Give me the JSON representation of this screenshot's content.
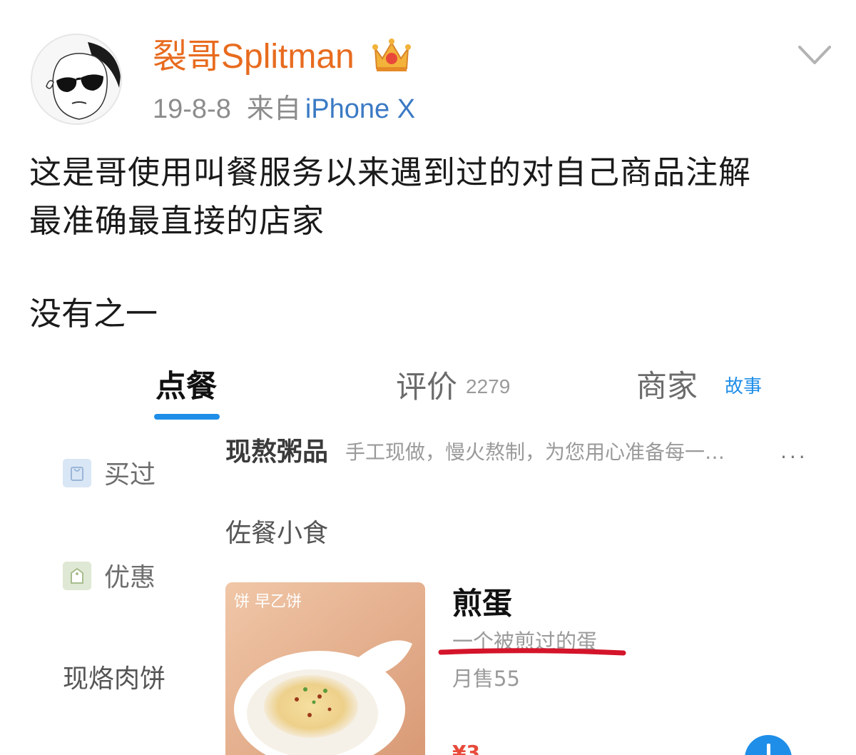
{
  "post": {
    "username": "裂哥Splitman",
    "date": "19-8-8",
    "from_label": "来自",
    "device": "iPhone X",
    "text_line1": "这是哥使用叫餐服务以来遇到过的对自己商品注解",
    "text_line2": "最准确最直接的店家",
    "text_line3": "没有之一"
  },
  "screenshot": {
    "tabs": {
      "order": "点餐",
      "reviews": "评价",
      "reviews_count": "2279",
      "merchant": "商家",
      "merchant_story": "故事"
    },
    "sidebar": {
      "bought": "买过",
      "discount": "优惠",
      "patty": "现烙肉饼"
    },
    "category1": {
      "title": "现熬粥品",
      "desc": "手工现做，慢火熬制，为您用心准备每一…"
    },
    "more": "···",
    "category2": {
      "title": "佐餐小食"
    },
    "item": {
      "name": "煎蛋",
      "desc": "一个被煎过的蛋",
      "sales": "月售55",
      "price_partial": "¥3",
      "image_logo": "饼 早乙饼"
    }
  },
  "colors": {
    "username": "#e86b1f",
    "device_link": "#3b7ac4",
    "accent_blue": "#1f8ee8",
    "highlight_red": "#d4142a"
  },
  "icons": [
    "crown-icon",
    "chevron-down-icon",
    "bag-icon",
    "tag-icon",
    "more-icon",
    "plus-icon"
  ]
}
